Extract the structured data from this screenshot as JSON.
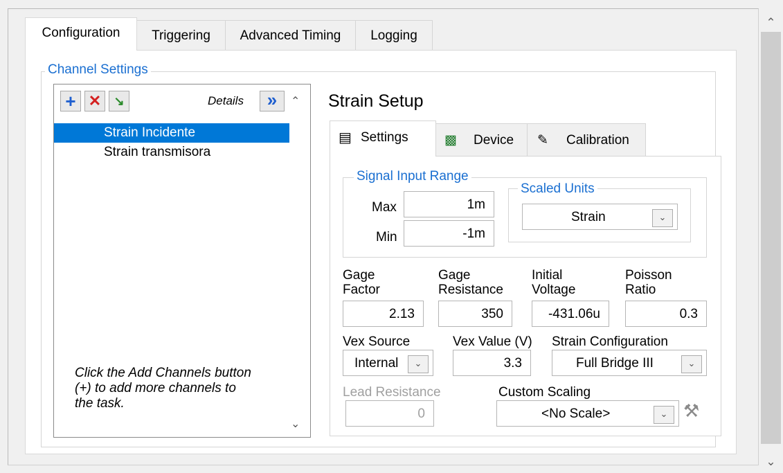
{
  "tabs": [
    "Configuration",
    "Triggering",
    "Advanced Timing",
    "Logging"
  ],
  "channel_settings": {
    "title": "Channel Settings",
    "toolbar": {
      "details_label": "Details",
      "details_button": "»"
    },
    "channels": [
      "Strain Incidente",
      "Strain transmisora"
    ],
    "hint": [
      "Click the Add Channels button",
      "(+) to add more channels to",
      "the task."
    ]
  },
  "setup": {
    "title": "Strain Setup",
    "tabs": [
      "Settings",
      "Device",
      "Calibration"
    ],
    "signal_input_range": {
      "title": "Signal Input Range",
      "max_label": "Max",
      "max_value": "1m",
      "min_label": "Min",
      "min_value": "-1m"
    },
    "scaled_units": {
      "title": "Scaled Units",
      "value": "Strain"
    },
    "gage_factor": {
      "label_line1": "Gage",
      "label_line2": "Factor",
      "value": "2.13"
    },
    "gage_resistance": {
      "label_line1": "Gage",
      "label_line2": "Resistance",
      "value": "350"
    },
    "initial_voltage": {
      "label_line1": "Initial",
      "label_line2": "Voltage",
      "value": "-431.06u"
    },
    "poisson_ratio": {
      "label_line1": "Poisson",
      "label_line2": "Ratio",
      "value": "0.3"
    },
    "vex_source": {
      "label": "Vex Source",
      "value": "Internal"
    },
    "vex_value": {
      "label": "Vex Value (V)",
      "value": "3.3"
    },
    "strain_configuration": {
      "label": "Strain Configuration",
      "value": "Full Bridge III"
    },
    "lead_resistance": {
      "label": "Lead Resistance",
      "value": "0"
    },
    "custom_scaling": {
      "label": "Custom Scaling",
      "value": "<No Scale>"
    }
  },
  "colors": {
    "selection": "#0078d7",
    "group_title": "#1a6fd1",
    "add_icon": "#1f5fcf",
    "delete_icon": "#d42020"
  }
}
